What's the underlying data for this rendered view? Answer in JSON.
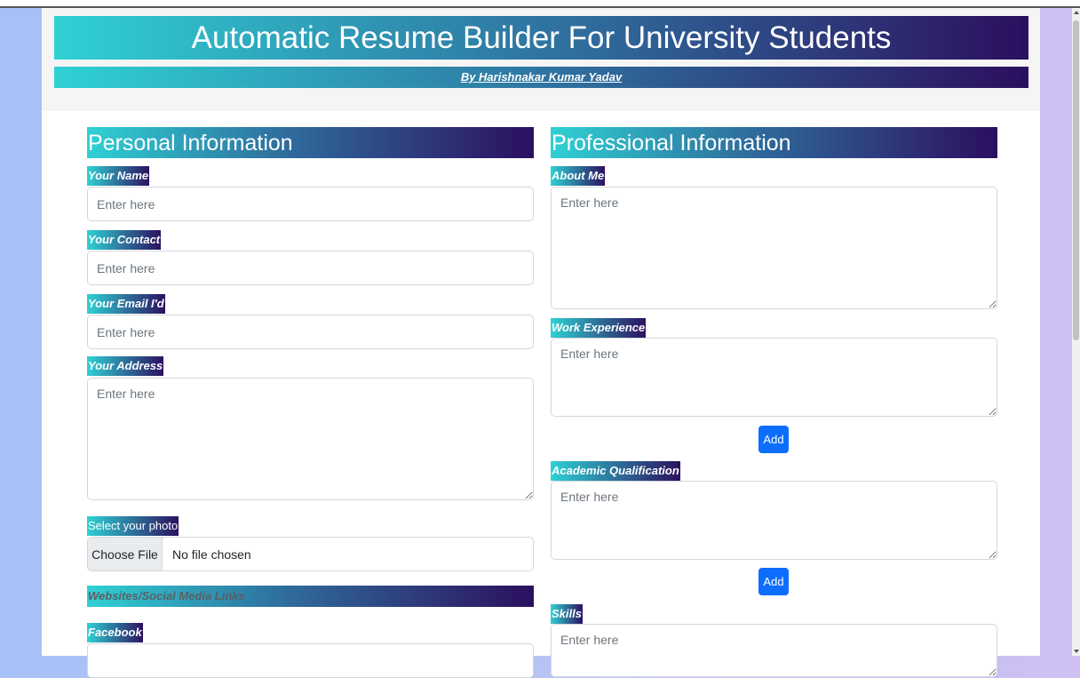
{
  "header": {
    "title": "Automatic Resume Builder For University Students",
    "byline": "By Harishnakar Kumar Yadav"
  },
  "personal": {
    "section_title": "Personal Information",
    "name_label": "Your Name",
    "contact_label": "Your Contact",
    "email_label": "Your Email I'd",
    "address_label": "Your Address",
    "photo_label": "Select your photo",
    "file_button": "Choose File",
    "file_status": "No file chosen",
    "links_heading": "Websites/Social Media Links",
    "facebook_label": "Facebook"
  },
  "professional": {
    "section_title": "Professional Information",
    "about_label": "About Me",
    "work_label": "Work Experience",
    "academic_label": "Academic Qualification",
    "skills_label": "Skills",
    "add_button": "Add"
  },
  "placeholder": "Enter here",
  "colors": {
    "gradient_start": "#2fd1d4",
    "gradient_end": "#2c0f5f",
    "button_blue": "#0d6efd"
  }
}
